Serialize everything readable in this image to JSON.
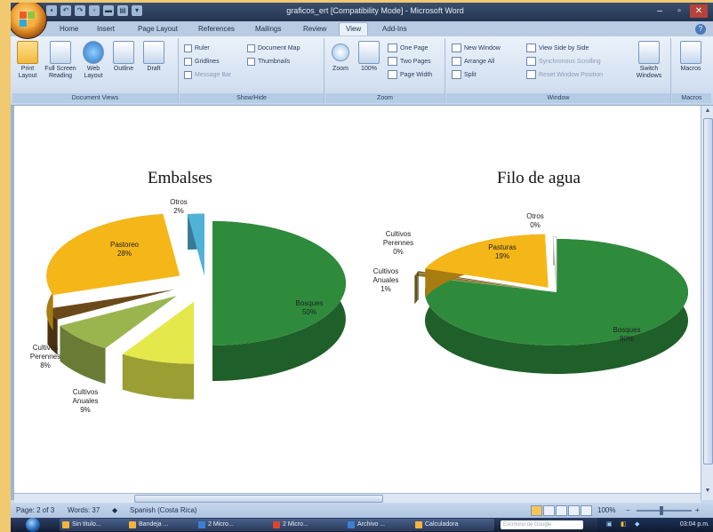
{
  "window": {
    "title": "graficos_ert [Compatibility Mode] - Microsoft Word",
    "controls": [
      "–",
      "▫",
      "✕"
    ]
  },
  "tabs": [
    "Home",
    "Insert",
    "Page Layout",
    "References",
    "Mailings",
    "Review",
    "View",
    "Add-Ins"
  ],
  "active_tab": "View",
  "ribbon": {
    "document_views": {
      "label": "Document Views",
      "buttons": [
        "Print Layout",
        "Full Screen Reading",
        "Web Layout",
        "Outline",
        "Draft"
      ]
    },
    "show_hide": {
      "label": "Show/Hide",
      "items": [
        "Ruler",
        "Gridlines",
        "Message Bar",
        "Document Map",
        "Thumbnails"
      ]
    },
    "zoom": {
      "label": "Zoom",
      "buttons": [
        "Zoom",
        "100%"
      ],
      "items": [
        "One Page",
        "Two Pages",
        "Page Width"
      ]
    },
    "window": {
      "label": "Window",
      "items": [
        "New Window",
        "Arrange All",
        "Split",
        "View Side by Side",
        "Synchronous Scrolling",
        "Reset Window Position"
      ],
      "switch": "Switch Windows"
    },
    "macros": {
      "label": "Macros",
      "button": "Macros"
    }
  },
  "status": {
    "page": "Page: 2 of 3",
    "words": "Words: 37",
    "language": "Spanish (Costa Rica)",
    "zoom": "100%"
  },
  "taskbar": {
    "items": [
      "Sin titulo...",
      "Bandeja ...",
      "2 Micro...",
      "2 Micro...",
      "Archivo ...",
      "Calculadora"
    ],
    "search_placeholder": "Escritorio de Google",
    "clock": "03:04 p.m."
  },
  "chart_data": [
    {
      "type": "pie",
      "title": "Embalses",
      "slices": [
        {
          "label": "Bosques",
          "value": 50,
          "text": "50%",
          "color": "#2e8b3c"
        },
        {
          "label": "Cultivos Anuales",
          "value": 9,
          "text": "9%",
          "color": "#e4e84a"
        },
        {
          "label": "Cultivos Perennes",
          "value": 8,
          "text": "8%",
          "color": "#9ab54e"
        },
        {
          "label": "",
          "value": 3,
          "text": "",
          "color": "#6b4a1a"
        },
        {
          "label": "Pastoreo",
          "value": 28,
          "text": "28%",
          "color": "#f5b618"
        },
        {
          "label": "Otros",
          "value": 2,
          "text": "2%",
          "color": "#4fb3d8"
        }
      ]
    },
    {
      "type": "pie",
      "title": "Filo de agua",
      "slices": [
        {
          "label": "Bosques",
          "value": 80,
          "text": "80%",
          "color": "#2e8b3c"
        },
        {
          "label": "Cultivos Anuales",
          "value": 1,
          "text": "1%",
          "color": "#8b7a2a"
        },
        {
          "label": "Cultivos Perennes",
          "value": 0,
          "text": "0%",
          "color": "#6b4a1a"
        },
        {
          "label": "Pasturas",
          "value": 19,
          "text": "19%",
          "color": "#f5b618"
        },
        {
          "label": "Otros",
          "value": 0,
          "text": "0%",
          "color": "#ffffff"
        }
      ]
    }
  ]
}
